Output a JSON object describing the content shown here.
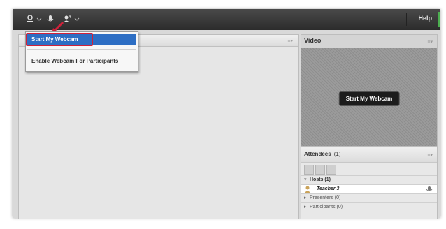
{
  "topbar": {
    "help_label": "Help"
  },
  "dropdown_menu": {
    "items": [
      {
        "label": "Start My Webcam",
        "selected": true
      },
      {
        "label": "Enable Webcam For Participants",
        "selected": false
      }
    ]
  },
  "video_pod": {
    "title": "Video",
    "button_label": "Start My Webcam"
  },
  "attendees_pod": {
    "title": "Attendees",
    "count": "(1)",
    "groups": [
      {
        "label": "Hosts (1)",
        "expanded": true
      },
      {
        "label": "Presenters (0)",
        "expanded": false
      },
      {
        "label": "Participants (0)",
        "expanded": false
      }
    ],
    "host_user": "Teacher 3"
  },
  "colors": {
    "accent": "#2d6ec4",
    "highlight": "#d0213a",
    "topbar": "#333333"
  }
}
